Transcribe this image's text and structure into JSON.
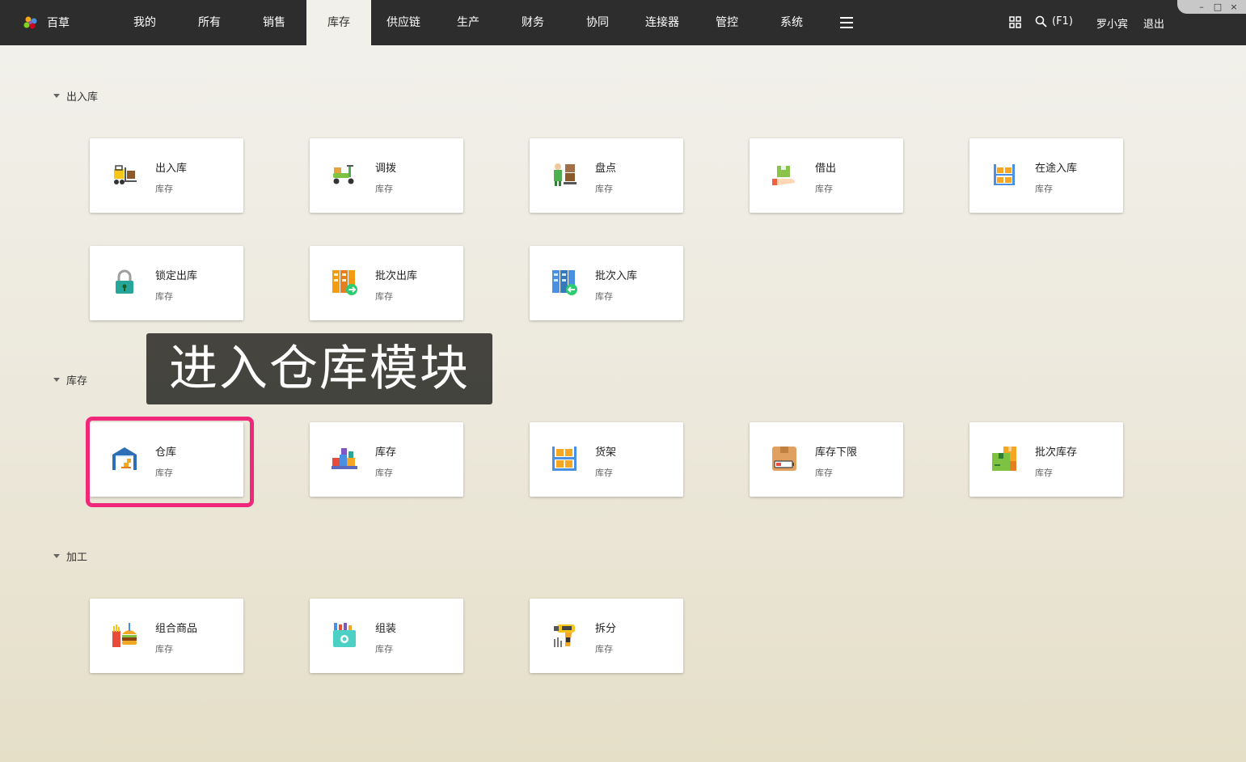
{
  "app": {
    "name": "百草"
  },
  "nav": {
    "items": [
      "我的",
      "所有",
      "销售",
      "库存",
      "供应链",
      "生产",
      "财务",
      "协同",
      "连接器",
      "管控",
      "系统"
    ],
    "active": "库存"
  },
  "header": {
    "search_label": "(F1)",
    "user": "罗小宾",
    "logout": "退出"
  },
  "window": {
    "minimize": "–",
    "maximize": "□",
    "close": "×"
  },
  "sections": [
    {
      "title": "出入库"
    },
    {
      "title": "库存"
    },
    {
      "title": "加工"
    }
  ],
  "cards": [
    {
      "title": "出入库",
      "sub": "库存",
      "icon": "forklift-icon"
    },
    {
      "title": "调拨",
      "sub": "库存",
      "icon": "scooter-icon"
    },
    {
      "title": "盘点",
      "sub": "库存",
      "icon": "worker-boxes-icon"
    },
    {
      "title": "借出",
      "sub": "库存",
      "icon": "hand-box-icon"
    },
    {
      "title": "在途入库",
      "sub": "库存",
      "icon": "shelf-boxes-icon"
    },
    {
      "title": "锁定出库",
      "sub": "库存",
      "icon": "lock-icon"
    },
    {
      "title": "批次出库",
      "sub": "库存",
      "icon": "batch-out-icon"
    },
    {
      "title": "批次入库",
      "sub": "库存",
      "icon": "batch-in-icon"
    },
    {
      "title": "仓库",
      "sub": "库存",
      "icon": "warehouse-icon"
    },
    {
      "title": "库存",
      "sub": "库存",
      "icon": "stock-icon"
    },
    {
      "title": "货架",
      "sub": "库存",
      "icon": "rack-icon"
    },
    {
      "title": "库存下限",
      "sub": "库存",
      "icon": "low-stock-icon"
    },
    {
      "title": "批次库存",
      "sub": "库存",
      "icon": "batch-stock-icon"
    },
    {
      "title": "组合商品",
      "sub": "库存",
      "icon": "combo-food-icon"
    },
    {
      "title": "组装",
      "sub": "库存",
      "icon": "assembly-icon"
    },
    {
      "title": "拆分",
      "sub": "库存",
      "icon": "split-tool-icon"
    }
  ],
  "overlay_text": "进入仓库模块",
  "colors": {
    "topbar": "#2d2d2d",
    "highlight": "#f0287a",
    "active_tab": "#f1f0eb"
  }
}
